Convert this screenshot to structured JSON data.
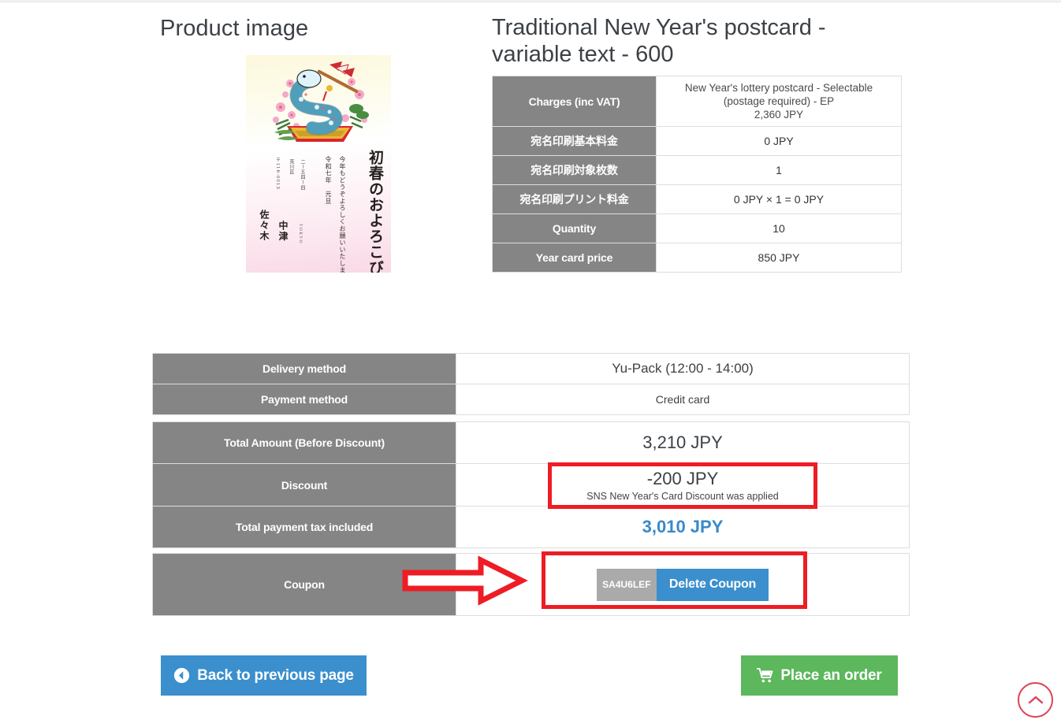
{
  "headings": {
    "product_image": "Product image",
    "product_title": "Traditional New Year's postcard - variable text - 600"
  },
  "product_image": {
    "alt": "Japanese New Year's postcard with snake illustration",
    "vertical_main": "初春のおよろこびを申し上げます",
    "vertical_greeting": "今年もどうぞよろしくお願いいたします",
    "vertical_date": "令和七年　元旦",
    "vertical_address_1": "荒川区",
    "vertical_address_2": "二ー五四ー四",
    "vertical_zip": "〒116-0013",
    "name_family": "佐々木",
    "name_given": "中津",
    "romaji": "TOKYO"
  },
  "charges_table": {
    "rows": [
      {
        "label": "Charges (inc VAT)",
        "value": "New Year's lottery postcard - Selectable\n(postage required) - EP\n2,360 JPY",
        "multiline": true
      },
      {
        "label": "宛名印刷基本料金",
        "value": "0 JPY",
        "multiline": false
      },
      {
        "label": "宛名印刷対象枚数",
        "value": "1",
        "multiline": false
      },
      {
        "label": "宛名印刷プリント料金",
        "value": "0 JPY × 1 = 0 JPY",
        "multiline": false
      },
      {
        "label": "Quantity",
        "value": "10",
        "multiline": false
      },
      {
        "label": "Year card price",
        "value": "850 JPY",
        "multiline": false
      }
    ]
  },
  "order_table_1": {
    "rows": [
      {
        "label": "Delivery method",
        "value": "Yu-Pack (12:00 - 14:00)"
      },
      {
        "label": "Payment method",
        "value": "Credit card"
      }
    ]
  },
  "order_table_2": {
    "total_before_discount_label": "Total Amount (Before Discount)",
    "total_before_discount_value": "3,210 JPY",
    "discount_label": "Discount",
    "discount_value": "-200 JPY",
    "discount_note": "SNS New Year's Card Discount was applied",
    "total_payment_label": "Total payment tax included",
    "total_payment_value": "3,010 JPY"
  },
  "coupon": {
    "label": "Coupon",
    "code": "SA4U6LEF",
    "delete_button": "Delete Coupon"
  },
  "buttons": {
    "back": "Back to previous page",
    "place_order": "Place an order"
  },
  "colors": {
    "header_gray": "#858585",
    "accent_blue": "#3b8fcd",
    "total_blue": "#3989cb",
    "order_green": "#5cb75d",
    "annotation_red": "#ee1c24",
    "scroll_top_red": "#de4459"
  }
}
